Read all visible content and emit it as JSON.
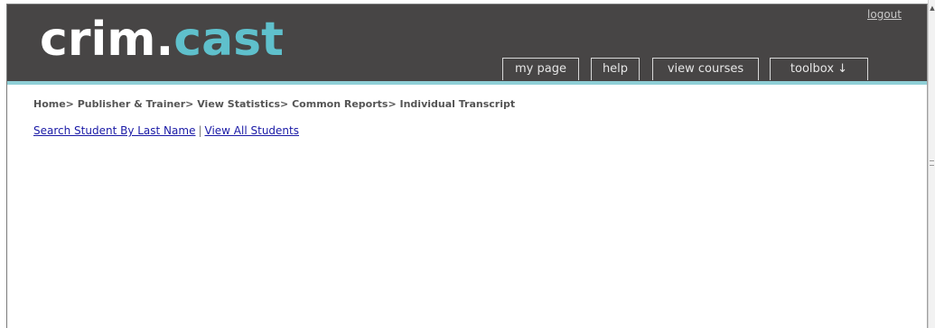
{
  "header": {
    "logo": {
      "part1": "crim",
      "dot": ".",
      "part2": "cast"
    },
    "logout_label": "logout",
    "tabs": [
      {
        "label": "my page"
      },
      {
        "label": "help"
      },
      {
        "label": "view courses"
      },
      {
        "label": "toolbox ↓"
      }
    ]
  },
  "breadcrumb": "Home> Publisher & Trainer> View Statistics> Common Reports> Individual Transcript",
  "links": {
    "search_label": "Search Student By Last Name",
    "separator": "|",
    "view_all_label": "View All Students"
  },
  "colors": {
    "header_bg": "#474545",
    "accent": "#5fc0cc",
    "rule": "#8fcfd6",
    "link": "#1a1aa6"
  },
  "icons": {
    "toolbox_dropdown": "down-arrow-icon",
    "scroll_up": "scroll-up-arrow-icon"
  }
}
